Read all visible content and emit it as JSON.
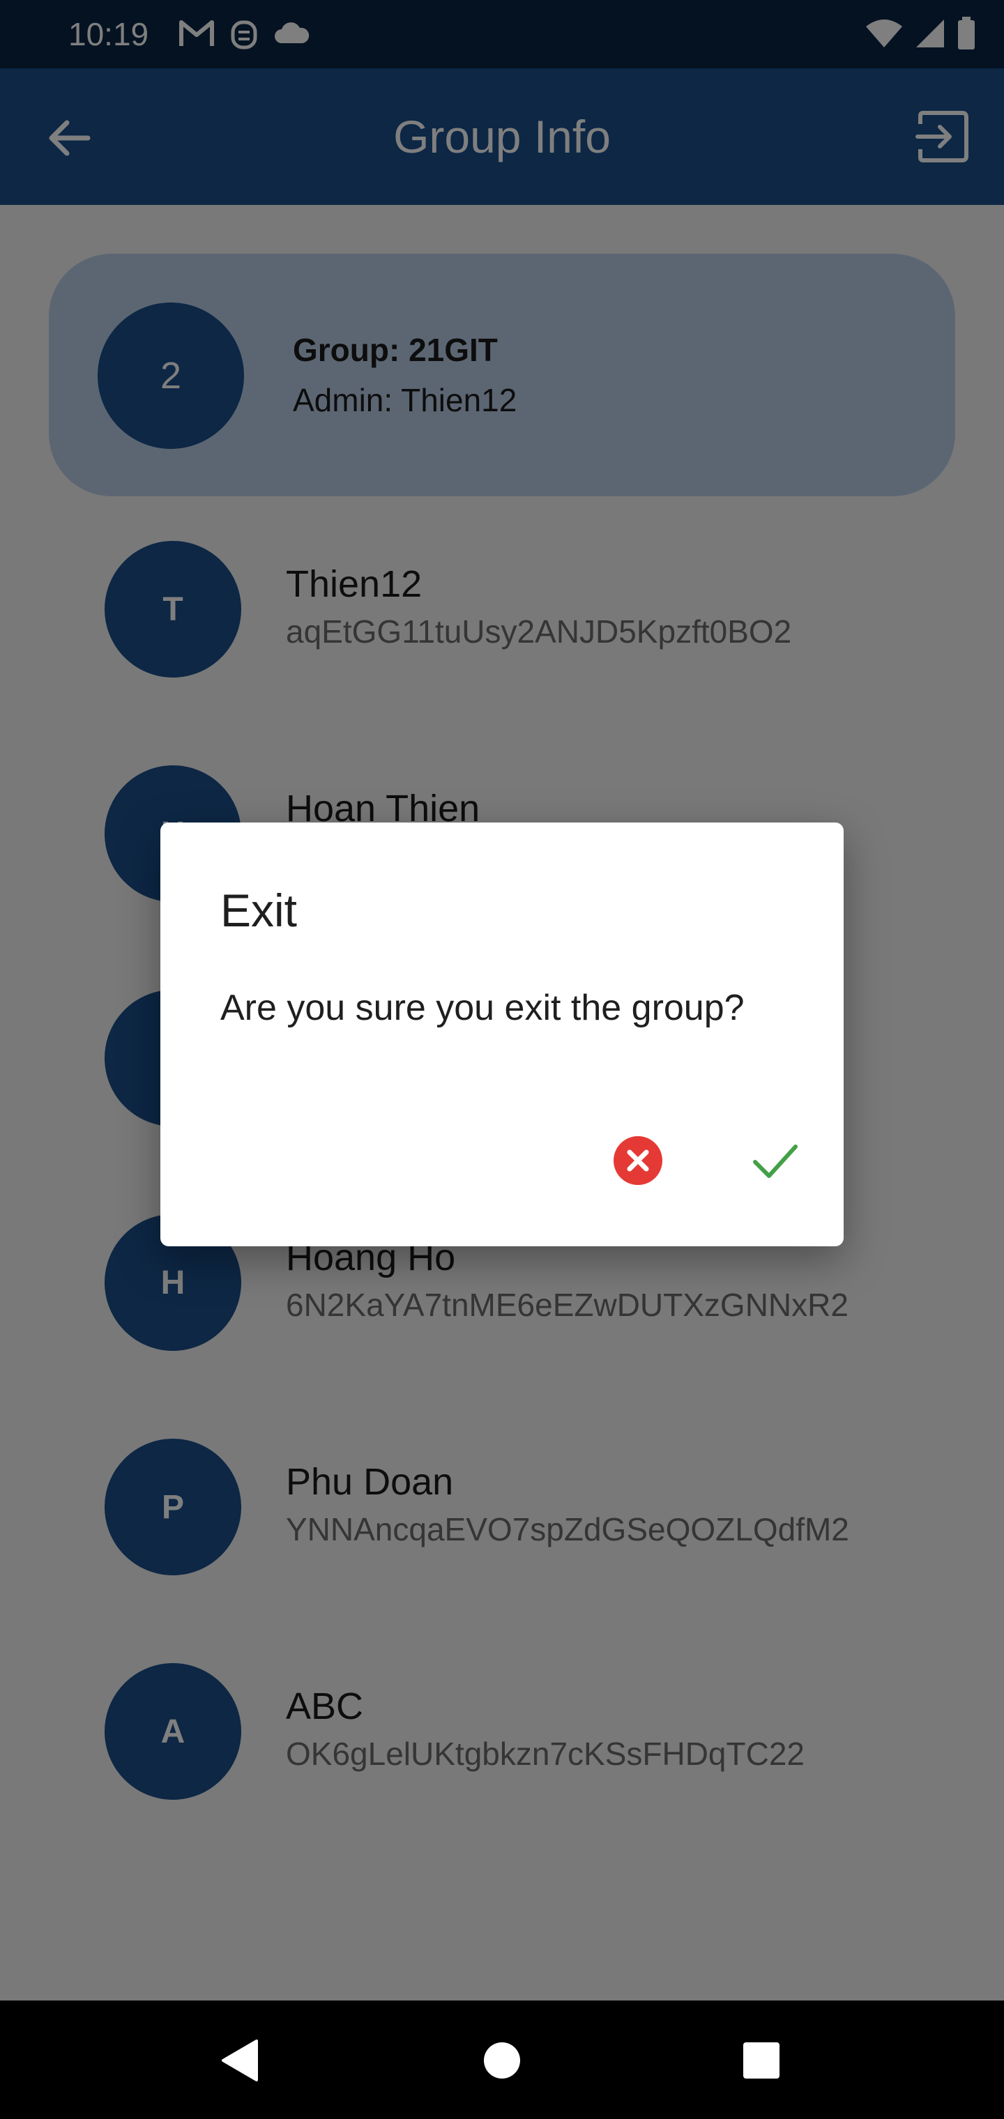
{
  "status_bar": {
    "time": "10:19",
    "left_icons": [
      "gmail-icon",
      "notification-icon",
      "cloud-icon"
    ],
    "right_icons": [
      "wifi-icon",
      "signal-icon",
      "battery-icon"
    ]
  },
  "app_bar": {
    "title": "Group Info",
    "back_icon": "arrow-back-icon",
    "exit_icon": "exit-to-app-icon"
  },
  "group": {
    "avatar_text": "2",
    "name": "Group: 21GIT",
    "admin": "Admin: Thien12"
  },
  "members": [
    {
      "initial": "T",
      "name": "Thien12",
      "uid": "aqEtGG11tuUsy2ANJD5Kpzft0BO2"
    },
    {
      "initial": "H",
      "name": "Hoan Thien",
      "uid": ""
    },
    {
      "initial": "",
      "name": "",
      "uid": ""
    },
    {
      "initial": "H",
      "name": "Hoang Ho",
      "uid": "6N2KaYA7tnME6eEZwDUTXzGNNxR2"
    },
    {
      "initial": "P",
      "name": "Phu Doan",
      "uid": "YNNAncqaEVO7spZdGSeQOZLQdfM2"
    },
    {
      "initial": "A",
      "name": "ABC",
      "uid": "OK6gLelUKtgbkzn7cKSsFHDqTC22"
    }
  ],
  "dialog": {
    "title": "Exit",
    "message": "Are you sure you exit the group?",
    "cancel_icon": "cancel-icon",
    "confirm_icon": "check-icon"
  },
  "colors": {
    "primary": "#1a4f8a",
    "status_bar": "#0a2545",
    "cancel": "#e53935",
    "confirm": "#43a047"
  }
}
